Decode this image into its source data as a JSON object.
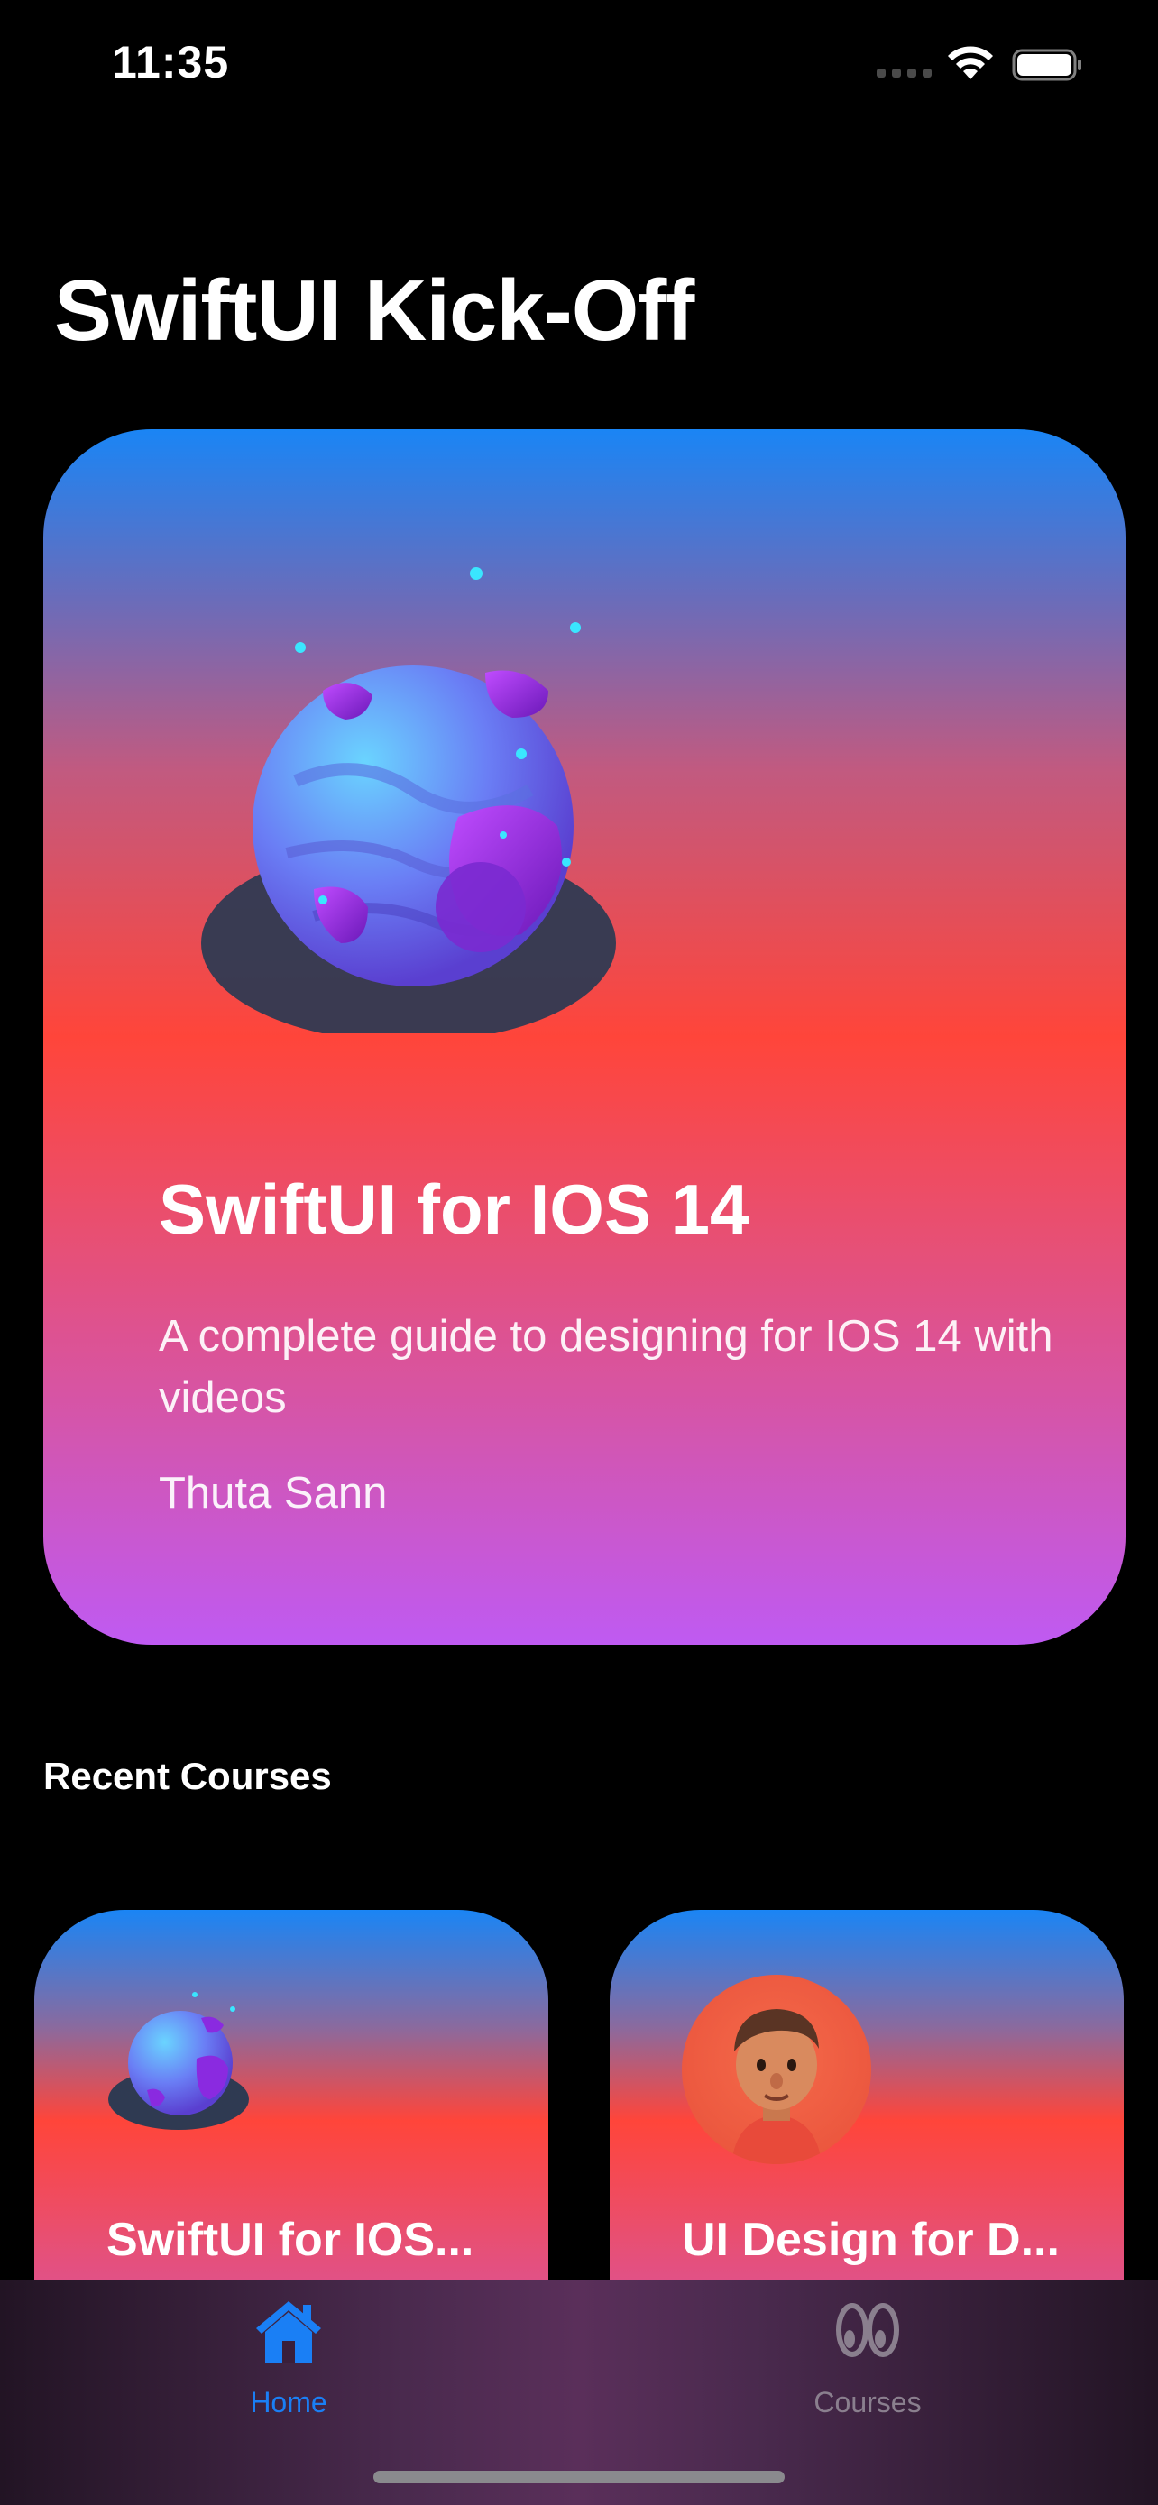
{
  "status_bar": {
    "time": "11:35",
    "icons": [
      "cellular-signal-icon",
      "wifi-icon",
      "battery-icon"
    ]
  },
  "header": {
    "title": "SwiftUI Kick-Off"
  },
  "featured_course": {
    "title": "SwiftUI for IOS 14",
    "subtitle": "A complete guide to designing for IOS 14 with videos",
    "author": "Thuta Sann",
    "image": "planet-illustration",
    "gradient": [
      "#1a85f5",
      "#ff453a",
      "#bf5af2"
    ]
  },
  "recent_courses": {
    "section_title": "Recent Courses",
    "items": [
      {
        "title": "SwiftUI for IOS...",
        "image": "planet-illustration"
      },
      {
        "title": "UI Design for D...",
        "image": "avatar-illustration"
      }
    ]
  },
  "tab_bar": {
    "tabs": [
      {
        "label": "Home",
        "icon": "house-icon",
        "selected": true
      },
      {
        "label": "Courses",
        "icon": "eyes-icon",
        "selected": false
      }
    ],
    "accent": "#1a7ff5"
  }
}
